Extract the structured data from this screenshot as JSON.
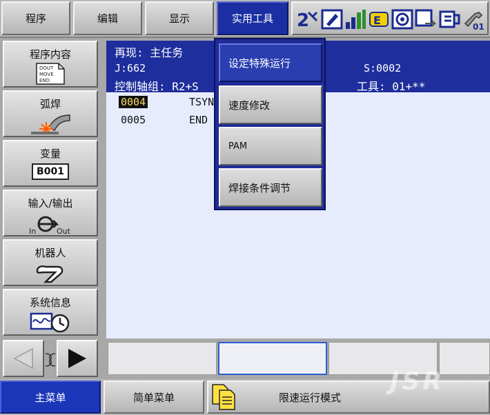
{
  "top_menu": {
    "items": [
      {
        "label": "程序"
      },
      {
        "label": "编辑"
      },
      {
        "label": "显示"
      },
      {
        "label": "实用工具"
      }
    ],
    "status_icons": [
      "coord-2-icon",
      "edit-lock-icon",
      "speed-level-icon",
      "robot-mode-icon",
      "play-mode-icon",
      "step-icon",
      "cycle-icon",
      "tool-01-icon"
    ],
    "status_tool_text": "01"
  },
  "left_menu": {
    "items": [
      {
        "label": "程序内容",
        "icon": "job-document-icon",
        "icon_text": [
          "DOUT",
          "MOVE",
          "END"
        ]
      },
      {
        "label": "弧焊",
        "icon": "arc-weld-icon"
      },
      {
        "label": "变量",
        "icon": "variable-icon",
        "icon_text": "B001"
      },
      {
        "label": "输入/输出",
        "icon": "io-icon",
        "icon_text_in": "In",
        "icon_text_out": "Out"
      },
      {
        "label": "机器人",
        "icon": "robot-arm-icon"
      },
      {
        "label": "系统信息",
        "icon": "system-info-icon"
      }
    ]
  },
  "job": {
    "title": "再现: 主任务",
    "j_label": "J:662",
    "s_label": "S:0002",
    "axis_label": "控制轴组: R2+S",
    "tool_label": "工具: 01+**",
    "lines": [
      {
        "no": "0004",
        "instr": "TSYN",
        "selected": true
      },
      {
        "no": "0005",
        "instr": "END",
        "selected": false
      }
    ]
  },
  "dropdown": {
    "items": [
      {
        "label": "设定特殊运行",
        "active": true
      },
      {
        "label": "速度修改",
        "active": false
      },
      {
        "label": "PAM",
        "active": false
      },
      {
        "label": "焊接条件调节",
        "active": false
      }
    ]
  },
  "bottom": {
    "main_menu": "主菜单",
    "simple_menu": "简单菜单",
    "mode": "限速运行模式"
  },
  "watermark": "JSR",
  "colors": {
    "accent": "#1b2fa3",
    "selected_bg": "#111111",
    "selected_fg": "#ffdc64",
    "job_bg": "#e6ecfc"
  }
}
